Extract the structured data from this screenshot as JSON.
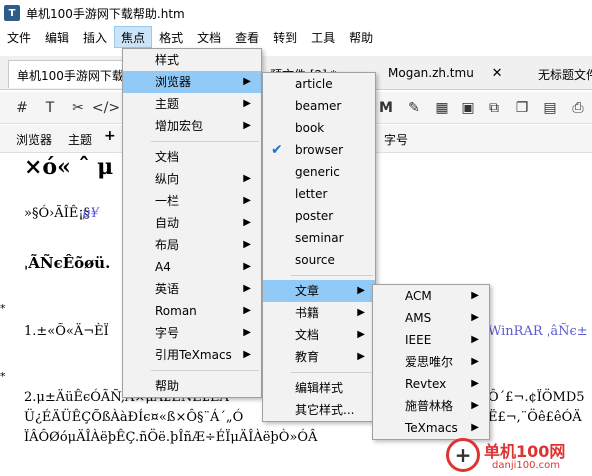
{
  "window": {
    "title": "单机100手游网下载帮助.htm",
    "icon": "texmacs-app-icon"
  },
  "menubar": [
    "文件",
    "编辑",
    "插入",
    "焦点",
    "格式",
    "文档",
    "查看",
    "转到",
    "工具",
    "帮助"
  ],
  "tabs": [
    {
      "label": "单机100手游网下载"
    },
    {
      "label": "预文件 [2] *"
    },
    {
      "label": "Mogan.zh.tmu",
      "close": "✕"
    },
    {
      "label": "无标题文件"
    }
  ],
  "toolbar2": {
    "browser": "浏览器",
    "theme": "主题",
    "plus": "+",
    "size": "字号"
  },
  "document": {
    "line1": "×ó«  ˆ μ",
    "line2": "»§Ó›ÃÎÊ¡§",
    "line2_tail": "μ¥",
    "line3": "ˌÃÑєÊõøü.",
    "line4": "1.±«Õ«Ä¬ÈÏ",
    "line4_tail": "WinRAR ˌâÑє±",
    "line5": "2.μ±ÄüÊєÓÃÑ,Ä×μÄ£ÈÑÊ£ÊÂ",
    "line5_tail": "Ô´£¬.¢ÏÖMD5",
    "line6": "Ü¿ÉÄÜÊÇÕßÀàÐÍє¤«ß×Ô§¨Á´„Ó",
    "line6_tail": "Ë£¬,¨Öê£êÓÄ",
    "line7": "ÏÂÔØóμÄÎÀëþÊÇ.ñÖë.þÎñÆ÷ÉÏμÄÎÀëþÒ»ÓÂ"
  },
  "menu_focus": {
    "items": [
      {
        "label": "样式",
        "submenu": false
      },
      {
        "label": "浏览器",
        "submenu": true,
        "highlight": true
      },
      {
        "label": "主题",
        "submenu": true
      },
      {
        "label": "增加宏包",
        "submenu": true
      },
      {
        "label": "文档",
        "submenu": false,
        "sep_before": true
      },
      {
        "label": "纵向",
        "submenu": true
      },
      {
        "label": "一栏",
        "submenu": true
      },
      {
        "label": "自动",
        "submenu": true
      },
      {
        "label": "布局",
        "submenu": true
      },
      {
        "label": "A4",
        "submenu": true
      },
      {
        "label": "英语",
        "submenu": true
      },
      {
        "label": "Roman",
        "submenu": true
      },
      {
        "label": "字号",
        "submenu": true
      },
      {
        "label": "引用TeXmacs",
        "submenu": true
      },
      {
        "label": "帮助",
        "submenu": false,
        "sep_before": true
      }
    ]
  },
  "menu_browser": {
    "items": [
      {
        "label": "article"
      },
      {
        "label": "beamer"
      },
      {
        "label": "book"
      },
      {
        "label": "browser",
        "checked": true
      },
      {
        "label": "generic"
      },
      {
        "label": "letter"
      },
      {
        "label": "poster"
      },
      {
        "label": "seminar"
      },
      {
        "label": "source"
      },
      {
        "label": "文章",
        "submenu": true,
        "highlight": true,
        "sep_before": true
      },
      {
        "label": "书籍",
        "submenu": true
      },
      {
        "label": "文档",
        "submenu": true
      },
      {
        "label": "教育",
        "submenu": true
      },
      {
        "label": "编辑样式",
        "sep_before": true
      },
      {
        "label": "其它样式..."
      }
    ]
  },
  "menu_article": {
    "items": [
      {
        "label": "ACM",
        "submenu": true
      },
      {
        "label": "AMS",
        "submenu": true
      },
      {
        "label": "IEEE",
        "submenu": true
      },
      {
        "label": "爱思唯尔",
        "submenu": true
      },
      {
        "label": "Revtex",
        "submenu": true
      },
      {
        "label": "施普林格",
        "submenu": true
      },
      {
        "label": "TeXmacs",
        "submenu": true
      }
    ]
  },
  "watermark": {
    "text": "单机100网",
    "sub": "danji100.com"
  }
}
